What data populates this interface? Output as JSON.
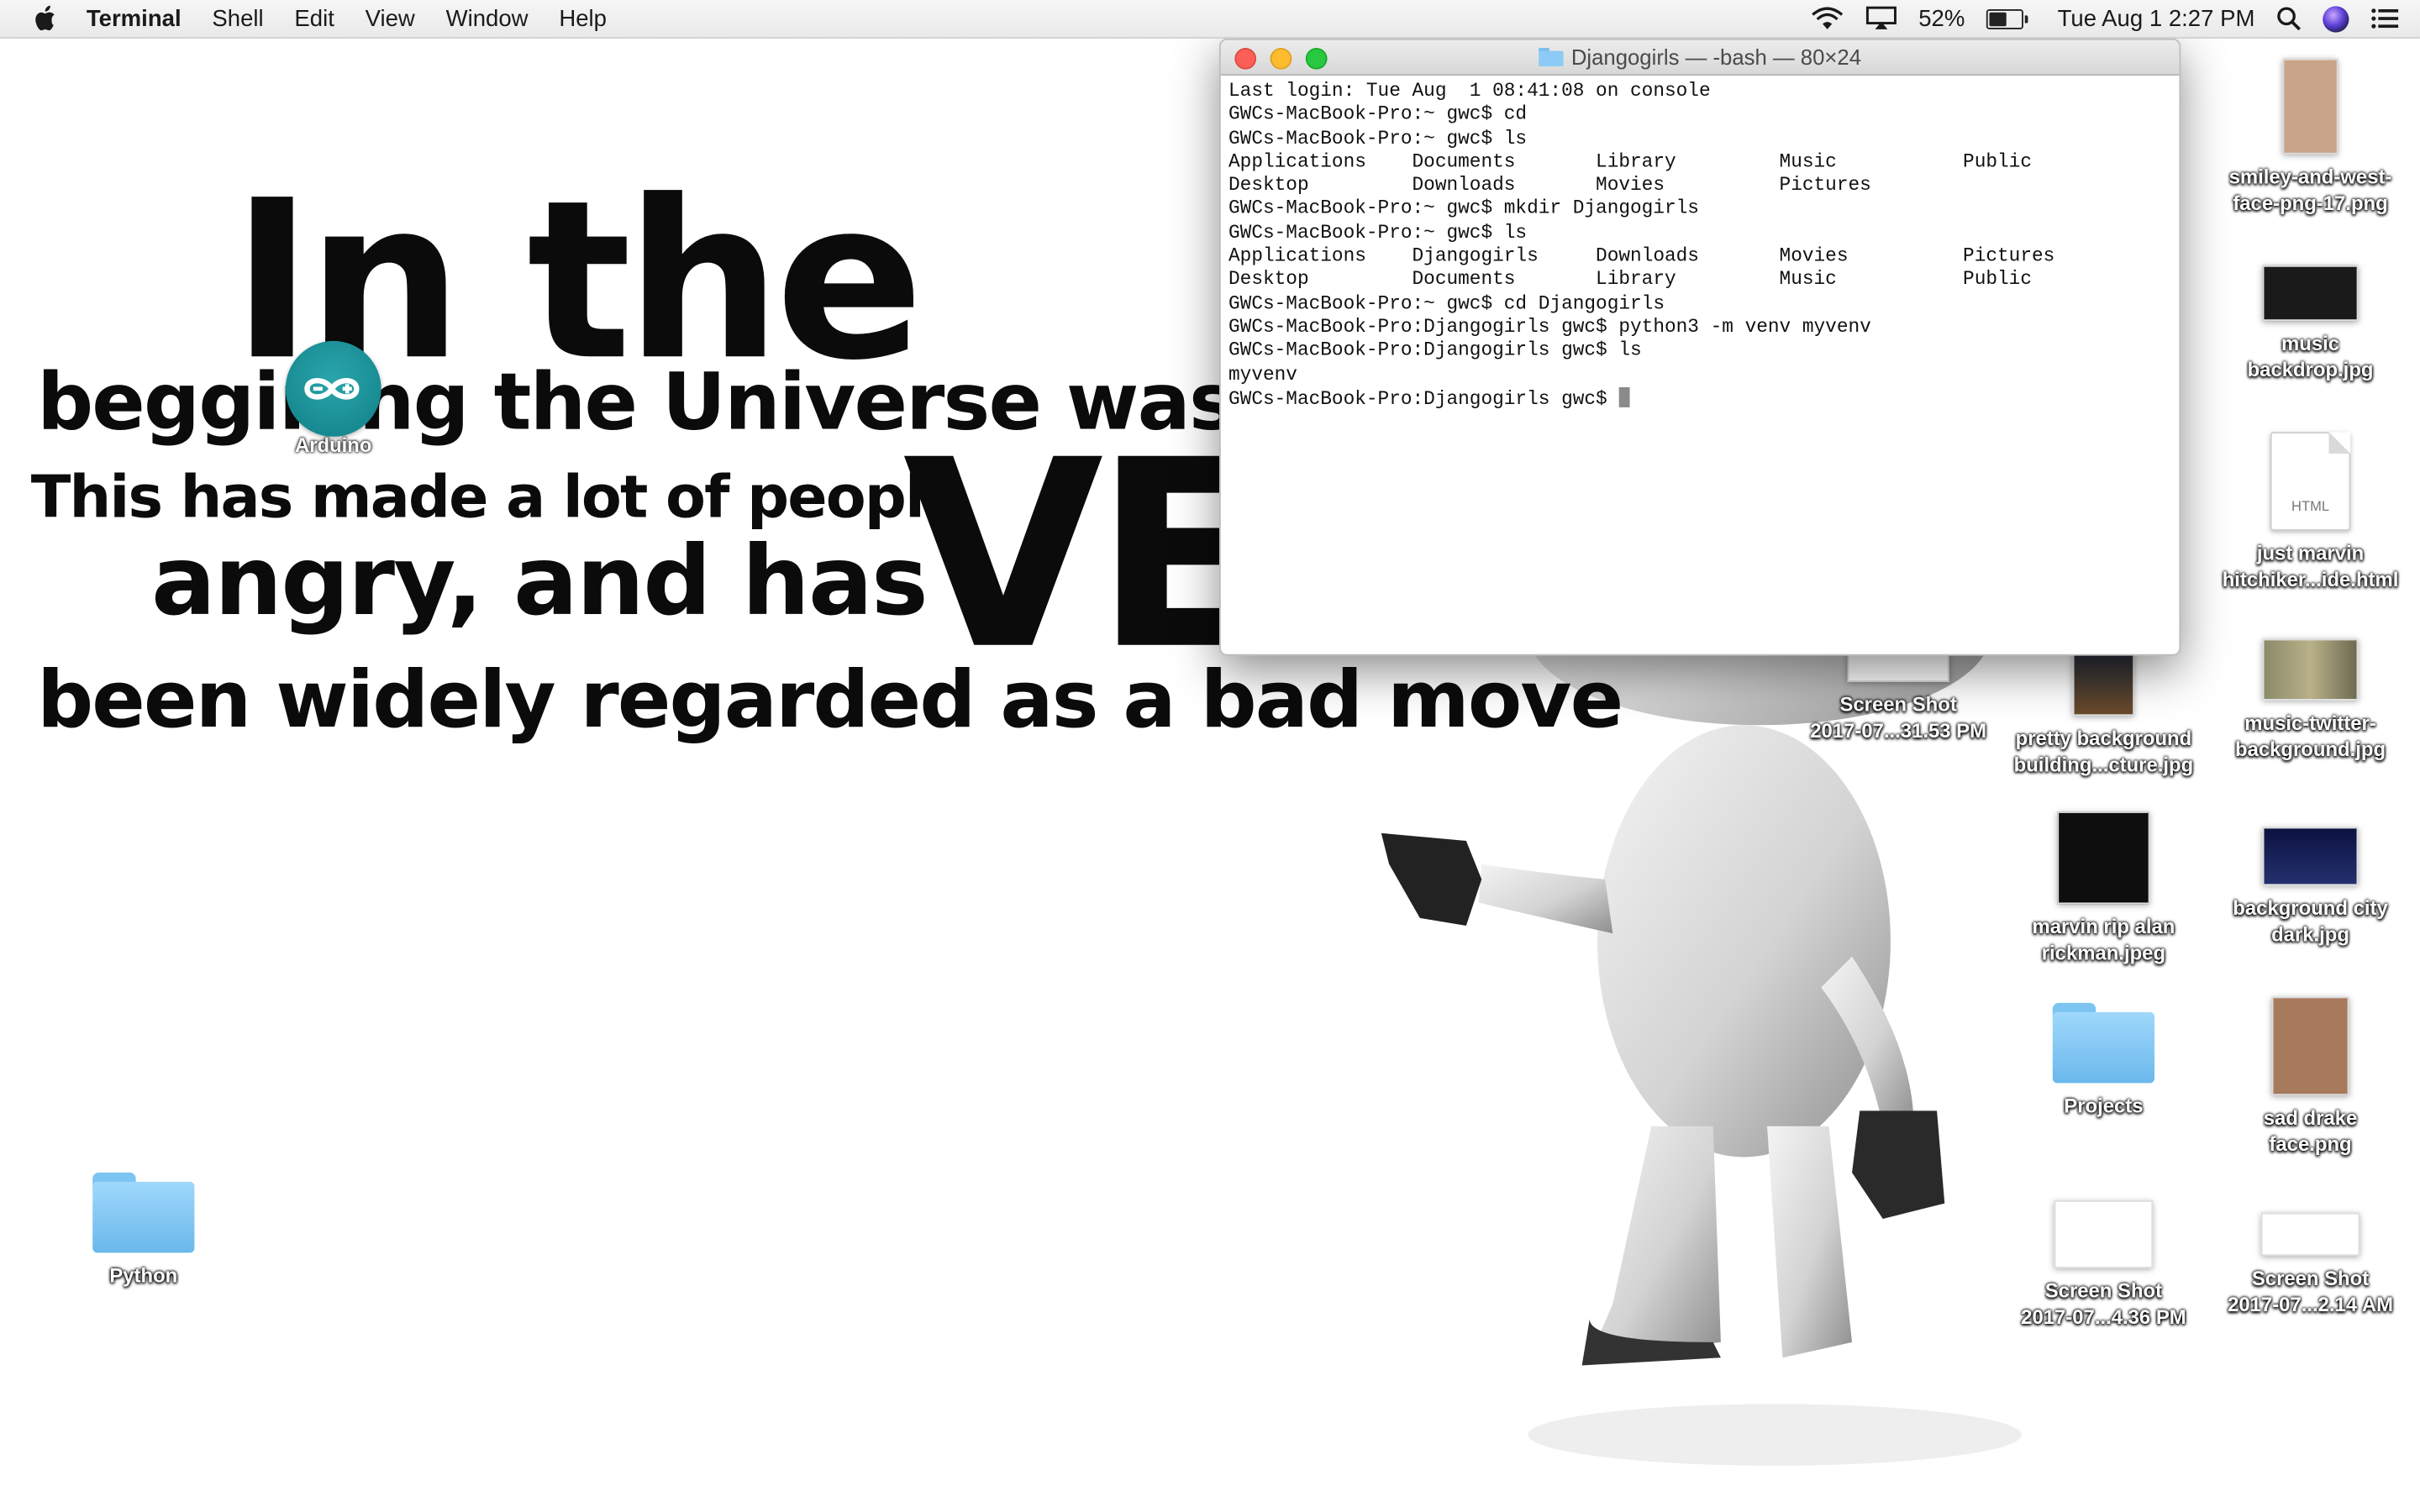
{
  "menubar": {
    "app": "Terminal",
    "items": [
      "Shell",
      "Edit",
      "View",
      "Window",
      "Help"
    ],
    "battery": "52%",
    "battery_level": 0.52,
    "datetime": "Tue Aug 1  2:27 PM"
  },
  "wallpaper": {
    "line1": "In the",
    "line2": "beggining the Universe was cre",
    "line3": "This has made a lot of people",
    "line4": "angry, and has",
    "line5": "VE",
    "line6": "been widely regarded as a bad move"
  },
  "arduino": {
    "label": "Arduino"
  },
  "terminal": {
    "title": "Djangogirls — -bash — 80×24",
    "lines": [
      "Last login: Tue Aug  1 08:41:08 on console",
      "GWCs-MacBook-Pro:~ gwc$ cd",
      "GWCs-MacBook-Pro:~ gwc$ ls",
      "Applications    Documents       Library         Music           Public",
      "Desktop         Downloads       Movies          Pictures",
      "GWCs-MacBook-Pro:~ gwc$ mkdir Djangogirls",
      "GWCs-MacBook-Pro:~ gwc$ ls",
      "Applications    Djangogirls     Downloads       Movies          Pictures",
      "Desktop         Documents       Library         Music           Public",
      "GWCs-MacBook-Pro:~ gwc$ cd Djangogirls",
      "GWCs-MacBook-Pro:Djangogirls gwc$ python3 -m venv myvenv",
      "GWCs-MacBook-Pro:Djangogirls gwc$ ls",
      "myvenv",
      "GWCs-MacBook-Pro:Djangogirls gwc$ "
    ]
  },
  "desktop": {
    "python": "Python",
    "screenshot1": "Screen Shot\n2017-07...31.53 PM",
    "smiley": "smiley-and-west-\nface-png-17.png",
    "music_backdrop": "music\nbackdrop.jpg",
    "just_marvin": "just marvin\nhitchiker...ide.html",
    "pretty_bg": "pretty background\nbuilding...cture.jpg",
    "music_twitter": "music-twitter-\nbackground.jpg",
    "marvin_rip": "marvin rip alan\nrickman.jpeg",
    "bg_city": "background city\ndark.jpg",
    "projects": "Projects",
    "sad_drake": "sad drake\nface.png",
    "screenshot2": "Screen Shot\n2017-07...4.36 PM",
    "screenshot3": "Screen Shot\n2017-07...2.14 AM",
    "html_tag": "HTML"
  }
}
